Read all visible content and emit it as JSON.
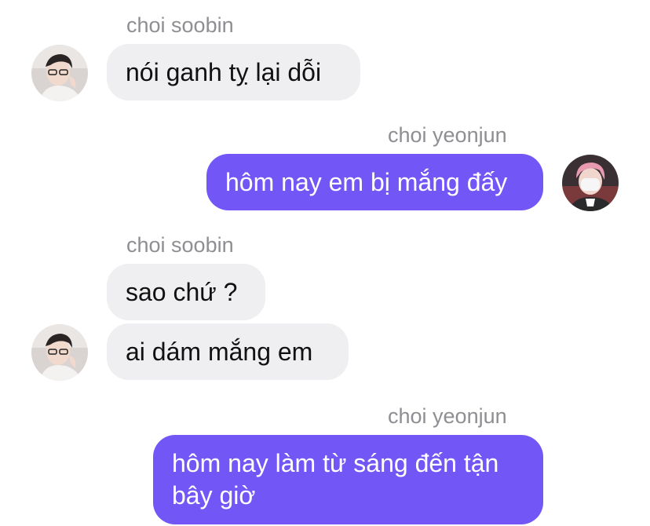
{
  "chat": {
    "colors": {
      "incoming_bubble": "#efeff1",
      "outgoing_bubble": "#7357f6",
      "sender_name": "#8e8e93"
    },
    "messages": [
      {
        "sender": "choi soobin",
        "text": "nói ganh tỵ lại dỗi",
        "direction": "incoming"
      },
      {
        "sender": "choi yeonjun",
        "text": "hôm nay em bị mắng đấy",
        "direction": "outgoing"
      },
      {
        "sender": "choi soobin",
        "text": "sao chứ ?",
        "direction": "incoming"
      },
      {
        "text": "ai dám mắng em",
        "direction": "incoming"
      },
      {
        "sender": "choi yeonjun",
        "text": "hôm nay làm từ sáng đến tận bây giờ",
        "direction": "outgoing"
      }
    ],
    "avatars": {
      "soobin": "avatar-photo",
      "yeonjun": "avatar-photo"
    }
  }
}
